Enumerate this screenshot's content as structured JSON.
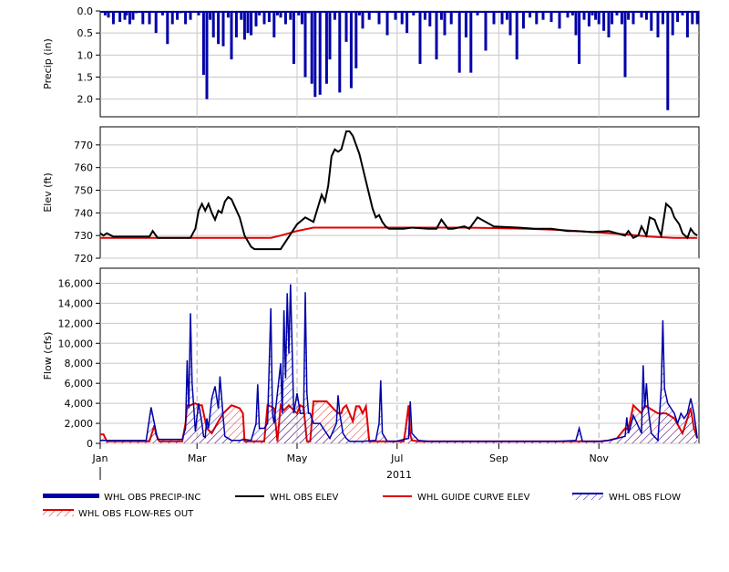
{
  "chart_data": {
    "type": "multi-panel-hydrograph",
    "year_label": "2011",
    "month_ticks": [
      "Jan",
      "Mar",
      "May",
      "Jul",
      "Sep",
      "Nov"
    ],
    "panels": [
      {
        "id": "precip",
        "type": "bar",
        "ylabel": "Precip (in)",
        "ylim": [
          0.0,
          2.4
        ],
        "inverted": true,
        "yticks": [
          "0.0",
          "0.5",
          "1.0",
          "1.5",
          "2.0"
        ],
        "ytick_values": [
          0.0,
          0.5,
          1.0,
          1.5,
          2.0
        ],
        "grid": true,
        "series": [
          {
            "name": "WHL OBS PRECIP-INC",
            "color": "#0000a8",
            "day": [
              3,
              5,
              8,
              12,
              15,
              16,
              18,
              20,
              22,
              26,
              30,
              34,
              38,
              41,
              44,
              47,
              49,
              52,
              55,
              60,
              63,
              65,
              67,
              69,
              72,
              75,
              78,
              80,
              83,
              86,
              88,
              90,
              92,
              95,
              97,
              100,
              103,
              106,
              108,
              110,
              113,
              116,
              118,
              121,
              123,
              125,
              127,
              129,
              131,
              134,
              138,
              140,
              143,
              146,
              150,
              153,
              156,
              158,
              160,
              164,
              170,
              175,
              180,
              184,
              187,
              191,
              195,
              198,
              201,
              205,
              208,
              210,
              214,
              219,
              223,
              226,
              230,
              235,
              240,
              245,
              248,
              250,
              254,
              258,
              262,
              266,
              270,
              275,
              280,
              285,
              288,
              290,
              292,
              295,
              298,
              300,
              302,
              304,
              307,
              310,
              312,
              315,
              318,
              320,
              322,
              325,
              330,
              333,
              336,
              340,
              343,
              346,
              349,
              352,
              355,
              358,
              361,
              364
            ],
            "value": [
              0.1,
              0.15,
              0.3,
              0.25,
              0.2,
              0.1,
              0.3,
              0.2,
              0.05,
              0.3,
              0.3,
              0.5,
              0.1,
              0.75,
              0.3,
              0.2,
              0.05,
              0.3,
              0.2,
              0.1,
              1.45,
              2.0,
              0.2,
              0.6,
              0.75,
              0.8,
              0.15,
              1.1,
              0.6,
              0.2,
              0.65,
              0.5,
              0.55,
              0.35,
              0.1,
              0.3,
              0.25,
              0.6,
              0.1,
              0.15,
              0.3,
              0.2,
              1.2,
              0.1,
              0.3,
              1.5,
              0.05,
              1.65,
              1.95,
              1.9,
              1.65,
              1.1,
              0.2,
              1.85,
              0.7,
              1.75,
              1.3,
              0.1,
              0.4,
              0.2,
              0.3,
              0.55,
              0.2,
              0.3,
              0.5,
              0.1,
              1.2,
              0.2,
              0.35,
              1.1,
              0.2,
              0.55,
              0.3,
              1.4,
              0.6,
              1.4,
              0.1,
              0.9,
              0.3,
              0.3,
              0.2,
              0.55,
              1.1,
              0.4,
              0.15,
              0.3,
              0.2,
              0.25,
              0.4,
              0.15,
              0.1,
              0.55,
              1.2,
              0.2,
              0.35,
              0.1,
              0.2,
              0.3,
              0.45,
              0.6,
              0.3,
              0.1,
              0.3,
              1.5,
              0.2,
              0.3,
              0.15,
              0.2,
              0.45,
              0.6,
              0.3,
              2.25,
              0.55,
              0.25,
              0.1,
              0.6,
              0.3,
              0.3
            ]
          }
        ]
      },
      {
        "id": "elev",
        "type": "line",
        "ylabel": "Elev (ft)",
        "ylim": [
          720,
          778
        ],
        "yticks": [
          "720",
          "730",
          "740",
          "750",
          "760",
          "770"
        ],
        "ytick_values": [
          720,
          730,
          740,
          750,
          760,
          770
        ],
        "grid": true,
        "series": [
          {
            "name": "WHL OBS ELEV",
            "color": "#000000",
            "day": [
              0,
              2,
              4,
              8,
              15,
              25,
              30,
              32,
              35,
              40,
              50,
              55,
              58,
              60,
              62,
              64,
              66,
              68,
              70,
              72,
              74,
              76,
              78,
              80,
              85,
              88,
              92,
              94,
              96,
              98,
              100,
              105,
              110,
              120,
              125,
              130,
              135,
              137,
              139,
              141,
              143,
              145,
              147,
              150,
              152,
              154,
              156,
              158,
              160,
              162,
              164,
              166,
              168,
              170,
              172,
              174,
              176,
              180,
              185,
              190,
              200,
              205,
              208,
              212,
              215,
              222,
              225,
              230,
              240,
              255,
              265,
              275,
              285,
              290,
              300,
              310,
              315,
              320,
              322,
              325,
              328,
              330,
              333,
              335,
              338,
              340,
              342,
              345,
              348,
              350,
              353,
              355,
              358,
              360,
              362,
              364
            ],
            "value": [
              731,
              730,
              731,
              729.5,
              729.5,
              729.5,
              729.5,
              732,
              729,
              729,
              729,
              729,
              733,
              741,
              744,
              741,
              744,
              740,
              737,
              741,
              740,
              745,
              747,
              746,
              738,
              730,
              725,
              724,
              724,
              724,
              724,
              724,
              724,
              735,
              738,
              736,
              748,
              745,
              752,
              765,
              768,
              767,
              768,
              776,
              776,
              774,
              770,
              766,
              760,
              754,
              748,
              742,
              738,
              739,
              736,
              734,
              733,
              733,
              733,
              733.5,
              733,
              733,
              737,
              733,
              733,
              734,
              733,
              738,
              734,
              733.5,
              733,
              733,
              732,
              732,
              731.5,
              732,
              731,
              730,
              732,
              729,
              730,
              734,
              730,
              738,
              737,
              733,
              730,
              744,
              742,
              738,
              735,
              731,
              729,
              733,
              731,
              730
            ]
          },
          {
            "name": "WHL GUIDE CURVE ELEV",
            "color": "#e00000",
            "day": [
              0,
              60,
              90,
              104,
              110,
              120,
              130,
              150,
              165,
              180,
              200,
              220,
              240,
              260,
              280,
              300,
              320,
              335,
              350,
              364
            ],
            "value": [
              729,
              729,
              729,
              729,
              730,
              732,
              733.5,
              733.5,
              733.5,
              733.5,
              733.5,
              733.5,
              733.3,
              733,
              732.5,
              731.5,
              730.5,
              729.5,
              729,
              729
            ]
          }
        ]
      },
      {
        "id": "flow",
        "type": "line",
        "ylabel": "Flow (cfs)",
        "ylim": [
          0,
          17500
        ],
        "yticks": [
          "0",
          "2,000",
          "4,000",
          "6,000",
          "8,000",
          "10,000",
          "12,000",
          "14,000",
          "16,000"
        ],
        "ytick_values": [
          0,
          2000,
          4000,
          6000,
          8000,
          10000,
          12000,
          14000,
          16000
        ],
        "grid": true,
        "series": [
          {
            "name": "WHL OBS FLOW",
            "color": "#0000a8",
            "day": [
              0,
              28,
              30,
              31,
              33,
              35,
              50,
              52,
              53,
              54,
              55,
              56,
              57,
              58,
              59,
              60,
              62,
              63,
              64,
              65,
              66,
              68,
              70,
              72,
              73,
              75,
              76,
              80,
              85,
              88,
              92,
              95,
              96,
              97,
              100,
              102,
              104,
              105,
              106,
              108,
              110,
              111,
              112,
              113,
              114,
              115,
              116,
              118,
              120,
              122,
              124,
              125,
              126,
              127,
              128,
              130,
              134,
              140,
              144,
              145,
              146,
              148,
              150,
              152,
              160,
              168,
              170,
              171,
              172,
              175,
              180,
              188,
              189,
              190,
              194,
              200,
              205,
              210,
              240,
              280,
              290,
              292,
              294,
              300,
              305,
              310,
              315,
              320,
              321,
              322,
              323,
              325,
              330,
              331,
              332,
              333,
              334,
              336,
              340,
              342,
              343,
              344,
              346,
              350,
              352,
              354,
              356,
              358,
              360,
              362,
              364
            ],
            "value": [
              300,
              300,
              2500,
              3600,
              2000,
              400,
              400,
              1500,
              8300,
              3500,
              13000,
              6000,
              3700,
              1200,
              2700,
              4000,
              2000,
              700,
              600,
              2500,
              1500,
              4500,
              5700,
              3500,
              6700,
              2500,
              700,
              300,
              300,
              400,
              300,
              2000,
              5900,
              1500,
              1500,
              2000,
              13500,
              3000,
              2000,
              5000,
              8000,
              3000,
              13300,
              6500,
              15000,
              9000,
              15900,
              3000,
              5000,
              3000,
              3000,
              15100,
              5000,
              3000,
              3000,
              2000,
              2000,
              500,
              2000,
              4800,
              3000,
              1000,
              500,
              200,
              200,
              300,
              2000,
              6300,
              1000,
              200,
              200,
              500,
              4200,
              1000,
              300,
              200,
              200,
              200,
              200,
              200,
              300,
              1500,
              200,
              200,
              200,
              300,
              500,
              700,
              2600,
              1000,
              1500,
              2800,
              1000,
              7800,
              3500,
              6000,
              3500,
              1000,
              300,
              5500,
              12300,
              5500,
              4000,
              3000,
              2000,
              3000,
              2500,
              3000,
              4500,
              3000,
              500
            ]
          },
          {
            "name": "WHL OBS FLOW-RES OUT",
            "color": "#e00000",
            "day": [
              0,
              2,
              4,
              6,
              30,
              33,
              34,
              36,
              50,
              52,
              53,
              55,
              58,
              60,
              62,
              65,
              68,
              72,
              75,
              80,
              82,
              85,
              87,
              88,
              90,
              97,
              100,
              102,
              104,
              106,
              108,
              110,
              112,
              115,
              118,
              120,
              122,
              124,
              126,
              128,
              130,
              134,
              138,
              142,
              145,
              147,
              148,
              150,
              152,
              154,
              156,
              158,
              160,
              162,
              164,
              166,
              168,
              170,
              172,
              175,
              180,
              185,
              186,
              188,
              189,
              190,
              194,
              220,
              240,
              260,
              280,
              290,
              300,
              305,
              310,
              315,
              320,
              322,
              325,
              330,
              332,
              335,
              340,
              345,
              350,
              355,
              360,
              362,
              364
            ],
            "value": [
              900,
              900,
              200,
              200,
              200,
              1800,
              900,
              200,
              200,
              2000,
              3800,
              3800,
              4000,
              3800,
              3800,
              1500,
              1000,
              2200,
              3000,
              3800,
              3700,
              3500,
              3000,
              200,
              200,
              200,
              200,
              3800,
              3700,
              3500,
              200,
              3800,
              3300,
              3800,
              3300,
              3000,
              3800,
              3600,
              200,
              200,
              4200,
              4200,
              4200,
              3500,
              3000,
              3000,
              3500,
              3800,
              3000,
              2200,
              3700,
              3700,
              3000,
              3700,
              200,
              200,
              200,
              200,
              200,
              200,
              200,
              200,
              1200,
              3800,
              900,
              300,
              200,
              200,
              200,
              200,
              200,
              200,
              200,
              200,
              300,
              500,
              1500,
              1400,
              3800,
              3000,
              3800,
              3500,
              3000,
              3000,
              2500,
              1000,
              3500,
              1500,
              500
            ]
          }
        ]
      }
    ],
    "legend": {
      "placement": "bottom",
      "entries": [
        {
          "name": "WHL OBS PRECIP-INC",
          "color": "#0000a8",
          "style": "thick"
        },
        {
          "name": "WHL OBS ELEV",
          "color": "#000000",
          "style": "line"
        },
        {
          "name": "WHL GUIDE CURVE ELEV",
          "color": "#e00000",
          "style": "line"
        },
        {
          "name": "WHL OBS FLOW",
          "color": "#0000a8",
          "style": "hatch"
        },
        {
          "name": "WHL OBS FLOW-RES OUT",
          "color": "#e00000",
          "style": "hatch"
        }
      ]
    }
  }
}
